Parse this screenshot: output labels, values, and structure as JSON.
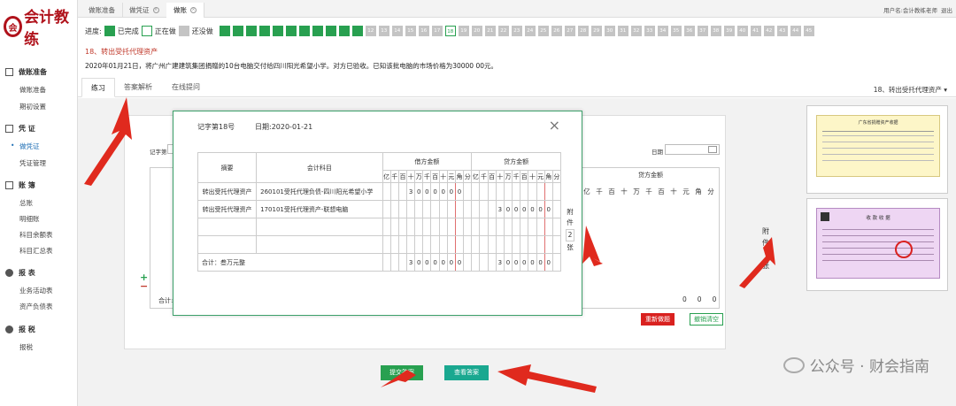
{
  "logo": {
    "text": "会计教练"
  },
  "sidebar": {
    "sections": [
      {
        "label": "做账准备",
        "icon": "edit-icon",
        "items": [
          "做账准备",
          "期初设置"
        ]
      },
      {
        "label": "凭 证",
        "icon": "voucher-icon",
        "items": [
          "做凭证",
          "凭证管理"
        ]
      },
      {
        "label": "账 簿",
        "icon": "ledger-icon",
        "items": [
          "总账",
          "明细账",
          "科目余额表",
          "科目汇总表"
        ]
      },
      {
        "label": "报 表",
        "icon": "report-icon",
        "items": [
          "业务活动表",
          "资产负债表"
        ]
      },
      {
        "label": "报 税",
        "icon": "tax-icon",
        "items": [
          "报税"
        ]
      }
    ],
    "active_item": "做凭证"
  },
  "topbar": {
    "tabs": [
      "做账准备",
      "做凭证",
      "做账"
    ],
    "active_tab": "做账",
    "user": "用户名:会计教练老师",
    "logout": "退出"
  },
  "progress": {
    "label": "进度:",
    "legend_done": "已完成",
    "legend_doing": "正在做",
    "legend_todo": "还没做",
    "done_count": 11,
    "current": 18,
    "total": 45,
    "numbers_visible": [
      "12",
      "13",
      "14",
      "15",
      "16",
      "17",
      "18",
      "19",
      "20",
      "21",
      "22",
      "23",
      "24",
      "25",
      "26",
      "27",
      "28",
      "29",
      "30",
      "31",
      "32",
      "33",
      "34",
      "35",
      "36",
      "37",
      "38",
      "39",
      "40",
      "41",
      "42",
      "43",
      "44",
      "45"
    ],
    "colors": {
      "done": "#28a050",
      "todo": "#c4c4c4"
    }
  },
  "question": {
    "title": "18、转出受托代理资产",
    "description": "2020年01月21日，将广州广建建筑集团捐赠的10台电脑交付给四川阳光希望小学。对方已验收。已知该批电脑的市场价格为30000 00元。"
  },
  "subtabs": {
    "items": [
      "练习",
      "答案解析",
      "在线提问"
    ],
    "active": "练习"
  },
  "right_label": "18、转出受托代理资产",
  "voucher_bg": {
    "word_label": "记字第",
    "date_label": "日期",
    "credit_header": "贷方金额",
    "digits": [
      "亿",
      "千",
      "百",
      "十",
      "万",
      "千",
      "百",
      "十",
      "元",
      "角",
      "分"
    ],
    "total_label": "合计:",
    "attach": [
      "附",
      "件",
      "张"
    ],
    "total_tail": [
      "0",
      "0",
      "0"
    ]
  },
  "dialog": {
    "word_no": "记字第18号",
    "date": "日期:2020-01-21",
    "headers": {
      "summary": "摘要",
      "account": "会计科目",
      "debit": "借方金额",
      "credit": "贷方金额"
    },
    "digits": [
      "亿",
      "千",
      "百",
      "十",
      "万",
      "千",
      "百",
      "十",
      "元",
      "角",
      "分"
    ],
    "rows": [
      {
        "summary": "转出受托代理资产",
        "account": "260101受托代理负债-四川阳光希望小学",
        "debit": [
          "",
          "",
          "",
          "3",
          "0",
          "0",
          "0",
          "0",
          "0",
          "0",
          ""
        ],
        "credit": [
          "",
          "",
          "",
          "",
          "",
          "",
          "",
          "",
          "",
          "",
          ""
        ]
      },
      {
        "summary": "转出受托代理资产",
        "account": "170101受托代理资产-联想电脑",
        "debit": [
          "",
          "",
          "",
          "",
          "",
          "",
          "",
          "",
          "",
          "",
          ""
        ],
        "credit": [
          "",
          "",
          "",
          "3",
          "0",
          "0",
          "0",
          "0",
          "0",
          "0",
          ""
        ]
      }
    ],
    "total_label": "合计：叁万元整",
    "total_debit": [
      "",
      "",
      "",
      "3",
      "0",
      "0",
      "0",
      "0",
      "0",
      "0",
      ""
    ],
    "total_credit": [
      "",
      "",
      "",
      "3",
      "0",
      "0",
      "0",
      "0",
      "0",
      "0",
      ""
    ],
    "attach_top": "附",
    "attach_mid": "件",
    "attach_count": "2",
    "attach_unit": "张"
  },
  "buttons": {
    "redo": "重新做题",
    "clear": "撤销清空",
    "submit": "提交答案",
    "view_answer": "查看答案"
  },
  "thumbs": {
    "receipt1_title": "广东省捐赠资产收据",
    "receipt2_title": "收 款 收 据"
  },
  "watermark": "公众号 · 财会指南"
}
